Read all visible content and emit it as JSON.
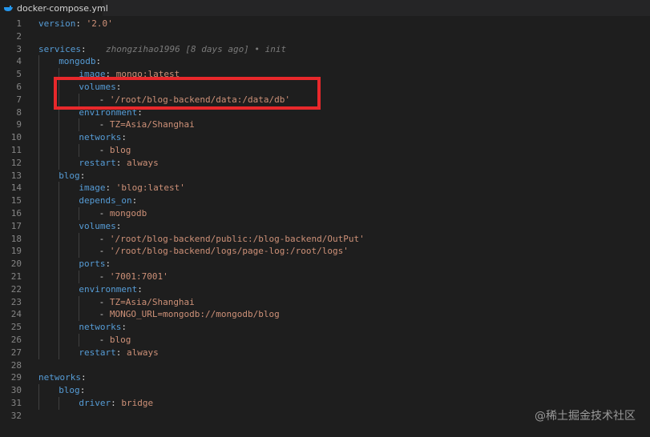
{
  "tab": {
    "icon": "docker-whale-icon",
    "filename": "docker-compose.yml"
  },
  "editor": {
    "blame": "zhongzihao1996 [8 days ago] • init",
    "lines": [
      {
        "n": "1",
        "indent": 0,
        "tokens": [
          {
            "c": "k",
            "t": "version"
          },
          {
            "c": "p",
            "t": ": "
          },
          {
            "c": "s",
            "t": "'2.0'"
          }
        ]
      },
      {
        "n": "2",
        "indent": 0,
        "tokens": []
      },
      {
        "n": "3",
        "indent": 0,
        "tokens": [
          {
            "c": "k",
            "t": "services"
          },
          {
            "c": "p",
            "t": ":"
          }
        ],
        "blame": true
      },
      {
        "n": "4",
        "indent": 1,
        "tokens": [
          {
            "c": "k",
            "t": "mongodb"
          },
          {
            "c": "p",
            "t": ":"
          }
        ]
      },
      {
        "n": "5",
        "indent": 2,
        "tokens": [
          {
            "c": "k",
            "t": "image"
          },
          {
            "c": "p",
            "t": ": "
          },
          {
            "c": "s",
            "t": "mongo:latest"
          }
        ]
      },
      {
        "n": "6",
        "indent": 2,
        "tokens": [
          {
            "c": "k",
            "t": "volumes"
          },
          {
            "c": "p",
            "t": ":"
          }
        ]
      },
      {
        "n": "7",
        "indent": 3,
        "tokens": [
          {
            "c": "p",
            "t": "- "
          },
          {
            "c": "s",
            "t": "'/root/blog-backend/data:/data/db'"
          }
        ]
      },
      {
        "n": "8",
        "indent": 2,
        "tokens": [
          {
            "c": "k",
            "t": "environment"
          },
          {
            "c": "p",
            "t": ":"
          }
        ]
      },
      {
        "n": "9",
        "indent": 3,
        "tokens": [
          {
            "c": "p",
            "t": "- "
          },
          {
            "c": "s",
            "t": "TZ=Asia/Shanghai"
          }
        ]
      },
      {
        "n": "10",
        "indent": 2,
        "tokens": [
          {
            "c": "k",
            "t": "networks"
          },
          {
            "c": "p",
            "t": ":"
          }
        ]
      },
      {
        "n": "11",
        "indent": 3,
        "tokens": [
          {
            "c": "p",
            "t": "- "
          },
          {
            "c": "s",
            "t": "blog"
          }
        ]
      },
      {
        "n": "12",
        "indent": 2,
        "tokens": [
          {
            "c": "k",
            "t": "restart"
          },
          {
            "c": "p",
            "t": ": "
          },
          {
            "c": "s",
            "t": "always"
          }
        ]
      },
      {
        "n": "13",
        "indent": 1,
        "tokens": [
          {
            "c": "k",
            "t": "blog"
          },
          {
            "c": "p",
            "t": ":"
          }
        ]
      },
      {
        "n": "14",
        "indent": 2,
        "tokens": [
          {
            "c": "k",
            "t": "image"
          },
          {
            "c": "p",
            "t": ": "
          },
          {
            "c": "s",
            "t": "'blog:latest'"
          }
        ]
      },
      {
        "n": "15",
        "indent": 2,
        "tokens": [
          {
            "c": "k",
            "t": "depends_on"
          },
          {
            "c": "p",
            "t": ":"
          }
        ]
      },
      {
        "n": "16",
        "indent": 3,
        "tokens": [
          {
            "c": "p",
            "t": "- "
          },
          {
            "c": "s",
            "t": "mongodb"
          }
        ]
      },
      {
        "n": "17",
        "indent": 2,
        "tokens": [
          {
            "c": "k",
            "t": "volumes"
          },
          {
            "c": "p",
            "t": ":"
          }
        ]
      },
      {
        "n": "18",
        "indent": 3,
        "tokens": [
          {
            "c": "p",
            "t": "- "
          },
          {
            "c": "s",
            "t": "'/root/blog-backend/public:/blog-backend/OutPut'"
          }
        ]
      },
      {
        "n": "19",
        "indent": 3,
        "tokens": [
          {
            "c": "p",
            "t": "- "
          },
          {
            "c": "s",
            "t": "'/root/blog-backend/logs/page-log:/root/logs'"
          }
        ]
      },
      {
        "n": "20",
        "indent": 2,
        "tokens": [
          {
            "c": "k",
            "t": "ports"
          },
          {
            "c": "p",
            "t": ":"
          }
        ]
      },
      {
        "n": "21",
        "indent": 3,
        "tokens": [
          {
            "c": "p",
            "t": "- "
          },
          {
            "c": "s",
            "t": "'7001:7001'"
          }
        ]
      },
      {
        "n": "22",
        "indent": 2,
        "tokens": [
          {
            "c": "k",
            "t": "environment"
          },
          {
            "c": "p",
            "t": ":"
          }
        ]
      },
      {
        "n": "23",
        "indent": 3,
        "tokens": [
          {
            "c": "p",
            "t": "- "
          },
          {
            "c": "s",
            "t": "TZ=Asia/Shanghai"
          }
        ]
      },
      {
        "n": "24",
        "indent": 3,
        "tokens": [
          {
            "c": "p",
            "t": "- "
          },
          {
            "c": "s",
            "t": "MONGO_URL=mongodb://mongodb/blog"
          }
        ]
      },
      {
        "n": "25",
        "indent": 2,
        "tokens": [
          {
            "c": "k",
            "t": "networks"
          },
          {
            "c": "p",
            "t": ":"
          }
        ]
      },
      {
        "n": "26",
        "indent": 3,
        "tokens": [
          {
            "c": "p",
            "t": "- "
          },
          {
            "c": "s",
            "t": "blog"
          }
        ]
      },
      {
        "n": "27",
        "indent": 2,
        "tokens": [
          {
            "c": "k",
            "t": "restart"
          },
          {
            "c": "p",
            "t": ": "
          },
          {
            "c": "s",
            "t": "always"
          }
        ]
      },
      {
        "n": "28",
        "indent": 0,
        "tokens": []
      },
      {
        "n": "29",
        "indent": 0,
        "tokens": [
          {
            "c": "k",
            "t": "networks"
          },
          {
            "c": "p",
            "t": ":"
          }
        ]
      },
      {
        "n": "30",
        "indent": 1,
        "tokens": [
          {
            "c": "k",
            "t": "blog"
          },
          {
            "c": "p",
            "t": ":"
          }
        ]
      },
      {
        "n": "31",
        "indent": 2,
        "tokens": [
          {
            "c": "k",
            "t": "driver"
          },
          {
            "c": "p",
            "t": ": "
          },
          {
            "c": "s",
            "t": "bridge"
          }
        ]
      },
      {
        "n": "32",
        "indent": 0,
        "tokens": []
      }
    ]
  },
  "watermark": "@稀土掘金技术社区",
  "colors": {
    "background": "#1e1e1e",
    "key": "#569cd6",
    "string": "#ce9178",
    "highlight_box": "#e8282b"
  }
}
